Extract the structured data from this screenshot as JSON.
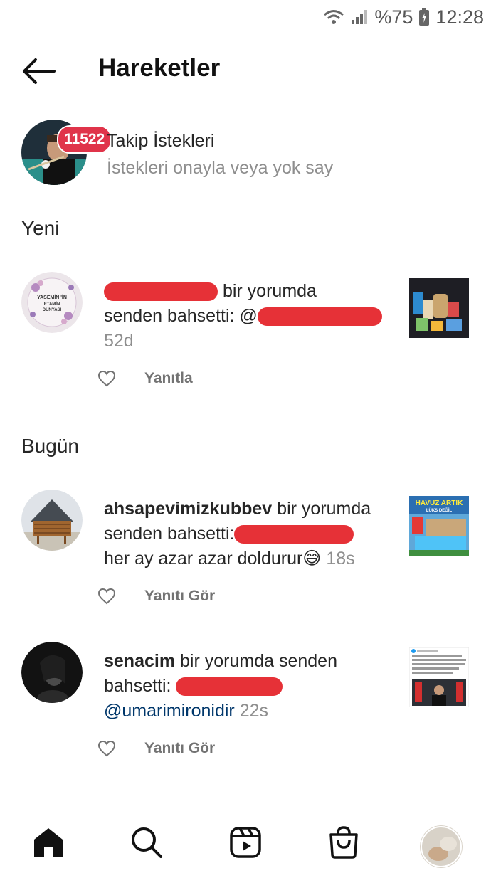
{
  "status_bar": {
    "battery": "%75",
    "time": "12:28"
  },
  "header": {
    "title": "Hareketler"
  },
  "follow_requests": {
    "badge": "11522",
    "title": "Takip İstekleri",
    "subtitle": "İstekleri onayla veya yok say"
  },
  "sections": {
    "new": "Yeni",
    "today": "Bugün"
  },
  "notifications": [
    {
      "avatar_text": [
        "YASEMİN 'İN",
        "ETAMİN",
        "DÜNYASI"
      ],
      "username": "",
      "action": "bir yorumda",
      "line2": "senden bahsetti: @",
      "time": "52d",
      "reply_label": "Yanıtla"
    },
    {
      "username": "ahsapevimizkubbev",
      "action": " bir yorumda",
      "line2": "senden bahsetti:",
      "line3": "her ay azar azar doldurur😅",
      "time": "18s",
      "thumb_title": "HAVUZ ARTIK",
      "thumb_sub": "LÜKS DEĞİL",
      "reply_label": "Yanıtı Gör"
    },
    {
      "username": "senacim",
      "action": " bir yorumda senden",
      "line2": "bahsetti:",
      "mention": "@umarimironidir",
      "time": "22s",
      "reply_label": "Yanıtı Gör"
    }
  ],
  "colors": {
    "accent_red": "#e0344a",
    "redaction": "#e63137",
    "mention": "#00376b"
  }
}
